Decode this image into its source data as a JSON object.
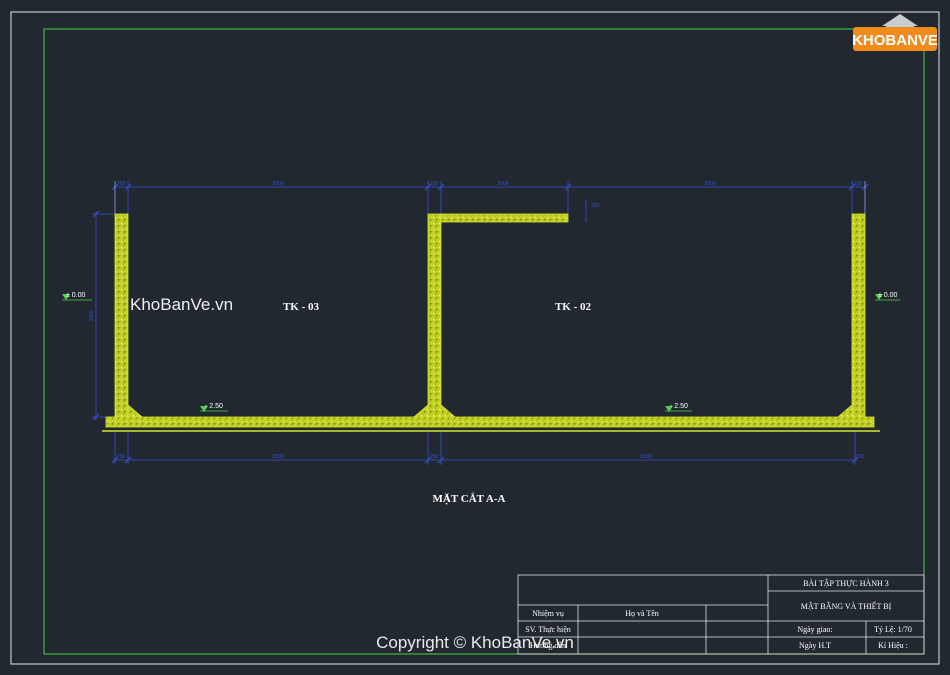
{
  "logo": {
    "text": "KHOBANVE"
  },
  "drawing": {
    "tank_left_label": "TK - 03",
    "tank_right_label": "TK - 02",
    "section_title": "MẶT CẮT A-A",
    "level_left_outer": "± 0.00",
    "level_right_outer": "± 0.00",
    "level_left_inner": "- 2.50",
    "level_right_inner": "- 2.50",
    "top_dims": [
      "250",
      "3000",
      "250",
      "2000",
      "3000",
      "250"
    ],
    "bottom_dims": [
      "250",
      "3000",
      "250",
      "5000",
      "250"
    ],
    "left_dim": "3000",
    "notch_dim": "250"
  },
  "watermark": {
    "center_text": "KhoBanVe.vn",
    "copyright_text": "Copyright © KhoBanVe.vn"
  },
  "title_block": {
    "project": "BÀI TẬP THỰC HÀNH 3",
    "drawing_name": "MẶT BẰNG VÀ THIẾT BỊ",
    "col_task": "Nhiệm vụ",
    "col_name": "Họ và Tên",
    "row_student": "SV. Thực hiện",
    "row_instructor": "Hướng dẫn",
    "date_given": "Ngày giao:",
    "scale": "Tỷ Lệ: 1/70",
    "date_done": "Ngày H.T",
    "symbol": "Kí Hiệu :"
  },
  "colors": {
    "background": "#212830",
    "border": "#e6e6e6",
    "inner_border": "#4fd14a",
    "concrete": "#d8e62c",
    "dimension": "#3a4fd6"
  }
}
